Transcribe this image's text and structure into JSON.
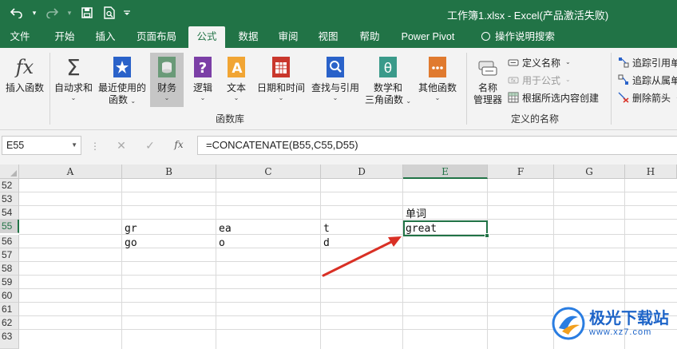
{
  "app": {
    "title": "工作簿1.xlsx  -  Excel(产品激活失败)"
  },
  "tabs": [
    {
      "label": "文件"
    },
    {
      "label": "开始"
    },
    {
      "label": "插入"
    },
    {
      "label": "页面布局"
    },
    {
      "label": "公式",
      "active": true
    },
    {
      "label": "数据"
    },
    {
      "label": "审阅"
    },
    {
      "label": "视图"
    },
    {
      "label": "帮助"
    },
    {
      "label": "Power Pivot"
    },
    {
      "label": "操作说明搜索"
    }
  ],
  "ribbon": {
    "insert_function": "插入函数",
    "autosum": "自动求和",
    "recently_used_1": "最近使用的",
    "recently_used_2": "函数",
    "financial": "财务",
    "logical": "逻辑",
    "text": "文本",
    "date_time": "日期和时间",
    "lookup_ref": "查找与引用",
    "math_trig_1": "数学和",
    "math_trig_2": "三角函数",
    "more_functions": "其他函数",
    "function_library_label": "函数库",
    "name_manager_1": "名称",
    "name_manager_2": "管理器",
    "define_name": "定义名称",
    "use_in_formula": "用于公式",
    "create_from_selection": "根据所选内容创建",
    "defined_names_label": "定义的名称",
    "trace_precedents": "追踪引用单",
    "trace_dependents": "追踪从属单",
    "remove_arrows": "删除箭头"
  },
  "formula_bar": {
    "name_box": "E55",
    "formula": "=CONCATENATE(B55,C55,D55)",
    "fx": "fx"
  },
  "grid": {
    "columns": [
      "A",
      "B",
      "C",
      "D",
      "E",
      "F",
      "G",
      "H"
    ],
    "active_column": "E",
    "rows": [
      "52",
      "53",
      "54",
      "55",
      "56",
      "57",
      "58",
      "59",
      "60",
      "61",
      "62",
      "63"
    ],
    "active_row": "55",
    "cells": {
      "E54": "单词",
      "B55": "gr",
      "C55": "ea",
      "D55": "t",
      "E55": "great",
      "B56": "go",
      "C56": "o",
      "D56": "d"
    }
  },
  "watermark": {
    "main": "极光下载站",
    "sub": "www.xz7.com"
  },
  "colors": {
    "accent": "#217346",
    "arrow": "#d93025"
  }
}
